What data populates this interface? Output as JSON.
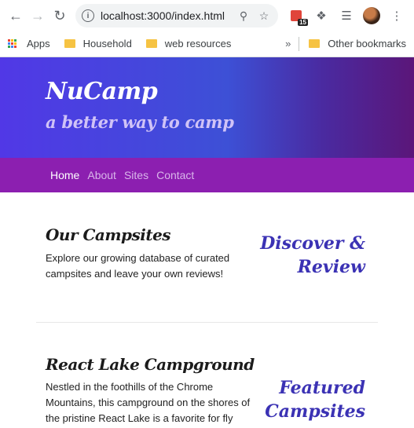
{
  "browser": {
    "url": "localhost:3000/index.html",
    "badge_count": "15",
    "bookmarks": {
      "apps": "Apps",
      "household": "Household",
      "web_resources": "web resources",
      "more": "»",
      "other": "Other bookmarks"
    }
  },
  "header": {
    "brand": "NuCamp",
    "tagline": "a better way to camp"
  },
  "nav": {
    "items": [
      "Home",
      "About",
      "Sites",
      "Contact"
    ]
  },
  "content": {
    "sections": [
      {
        "title": "Our Campsites",
        "text": "Explore our growing database of curated campsites and leave your own reviews!",
        "side": "Discover & Review"
      },
      {
        "title": "React Lake Campground",
        "text": "Nestled in the foothills of the Chrome Mountains, this campground on the shores of the pristine React Lake is a favorite for fly",
        "side": "Featured Campsites"
      }
    ]
  },
  "colors": {
    "nav_bg": "#8c1fb0",
    "accent_text": "#3b32b4"
  }
}
